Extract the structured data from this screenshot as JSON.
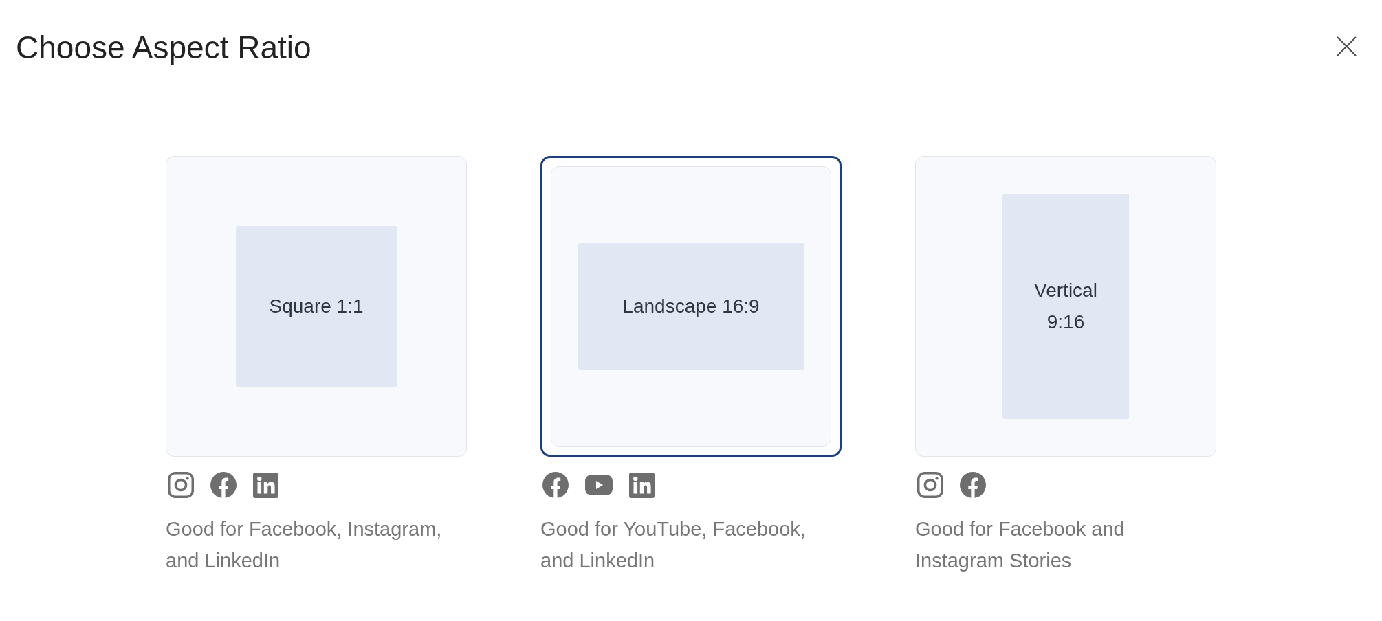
{
  "title": "Choose Aspect Ratio",
  "options": [
    {
      "kind": "square",
      "label": "Square 1:1",
      "selected": false,
      "icons": [
        {
          "kind": "instagram"
        },
        {
          "kind": "facebook"
        },
        {
          "kind": "linkedin"
        }
      ],
      "description": "Good for Facebook, Instagram, and LinkedIn"
    },
    {
      "kind": "landscape",
      "label": "Landscape 16:9",
      "selected": true,
      "icons": [
        {
          "kind": "facebook"
        },
        {
          "kind": "youtube"
        },
        {
          "kind": "linkedin"
        }
      ],
      "description": "Good for YouTube, Facebook, and LinkedIn"
    },
    {
      "kind": "vertical",
      "label": "Vertical 9:16",
      "selected": false,
      "icons": [
        {
          "kind": "instagram"
        },
        {
          "kind": "facebook"
        }
      ],
      "description": "Good for Facebook and Instagram Stories"
    }
  ]
}
